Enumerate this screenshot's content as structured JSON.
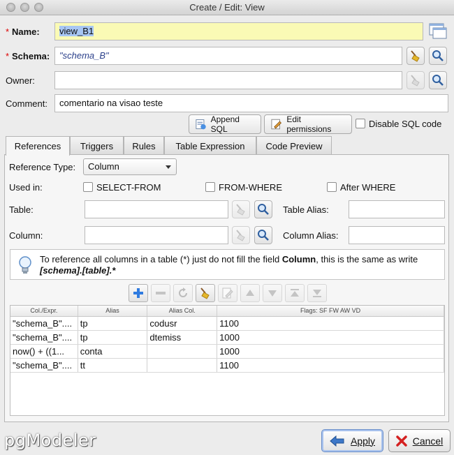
{
  "window": {
    "title": "Create / Edit: View"
  },
  "form": {
    "name_label": "Name:",
    "name_value": "view_B1",
    "schema_label": "Schema:",
    "schema_value": "\"schema_B\"",
    "owner_label": "Owner:",
    "owner_value": "",
    "comment_label": "Comment:",
    "comment_value": "comentario na visao teste",
    "required_mark": "*"
  },
  "actions": {
    "append_sql": "Append SQL",
    "edit_permissions": "Edit permissions",
    "disable_sql_code": "Disable SQL code"
  },
  "tabs": [
    "References",
    "Triggers",
    "Rules",
    "Table Expression",
    "Code Preview"
  ],
  "references": {
    "ref_type_label": "Reference Type:",
    "ref_type_value": "Column",
    "used_in_label": "Used in:",
    "used_in_options": [
      "SELECT-FROM",
      "FROM-WHERE",
      "After WHERE"
    ],
    "table_label": "Table:",
    "table_alias_label": "Table Alias:",
    "column_label": "Column:",
    "column_alias_label": "Column Alias:",
    "hint_prefix": "To reference all columns in a table (*) just do not fill the field ",
    "hint_bold": "Column",
    "hint_middle": ", this is the same as write ",
    "hint_code": "[schema].[table].*"
  },
  "grid": {
    "headers": [
      "Col./Expr.",
      "Alias",
      "Alias Col.",
      "Flags: SF FW AW VD"
    ],
    "rows": [
      [
        "\"schema_B\"....",
        "tp",
        "codusr",
        "1100"
      ],
      [
        "\"schema_B\"....",
        "tp",
        "dtemiss",
        "1000"
      ],
      [
        "now() + ((1...",
        "conta",
        "",
        "1000"
      ],
      [
        "\"schema_B\"....",
        "tt",
        "",
        "1100"
      ]
    ]
  },
  "footer": {
    "logo": "pgModeler",
    "apply": "Apply",
    "cancel": "Cancel"
  },
  "colors": {
    "accent": "#2f6fd6",
    "required": "#dd0000",
    "name_bg": "#fafab5"
  }
}
